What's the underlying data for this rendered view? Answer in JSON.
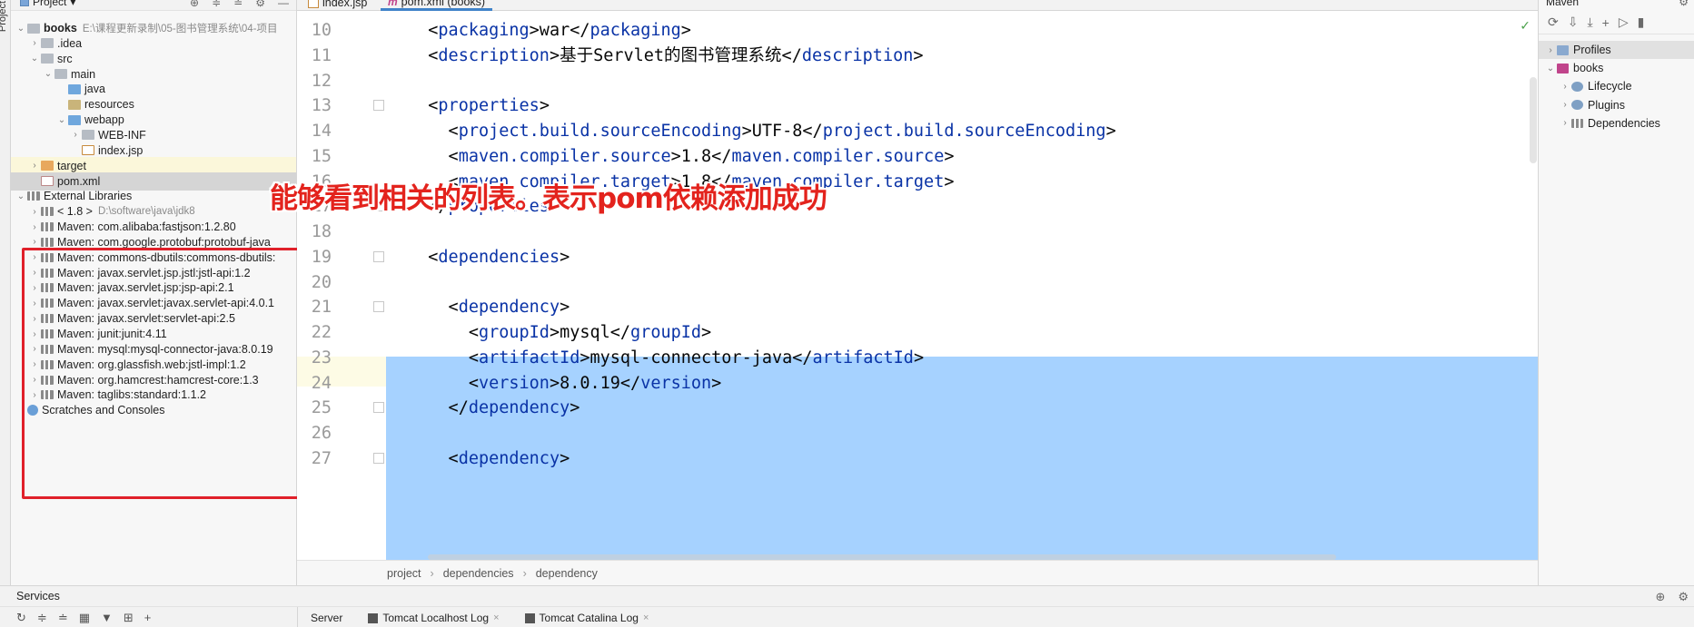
{
  "left_strip": {
    "label": "Project"
  },
  "project_panel": {
    "title": "Project",
    "tools": [
      "⊕",
      "≑",
      "≐",
      "⚙",
      "—"
    ],
    "root": {
      "name": "books",
      "path": "E:\\课程更新录制\\05-图书管理系统\\04-项目"
    },
    "items": [
      {
        "label": "books",
        "extra": "E:\\课程更新录制\\05-图书管理系统\\04-项目",
        "indent": 0,
        "arrow": "⌄",
        "icon": "folder",
        "bold": true,
        "name": "tree-root-books"
      },
      {
        "label": ".idea",
        "extra": "",
        "indent": 1,
        "arrow": "›",
        "icon": "folder",
        "name": "tree-idea"
      },
      {
        "label": "src",
        "extra": "",
        "indent": 1,
        "arrow": "⌄",
        "icon": "folder",
        "name": "tree-src"
      },
      {
        "label": "main",
        "extra": "",
        "indent": 2,
        "arrow": "⌄",
        "icon": "folder",
        "name": "tree-main"
      },
      {
        "label": "java",
        "extra": "",
        "indent": 3,
        "arrow": "",
        "icon": "bfolder",
        "name": "tree-java"
      },
      {
        "label": "resources",
        "extra": "",
        "indent": 3,
        "arrow": "",
        "icon": "rfolder",
        "name": "tree-resources"
      },
      {
        "label": "webapp",
        "extra": "",
        "indent": 3,
        "arrow": "⌄",
        "icon": "bfolder",
        "name": "tree-webapp"
      },
      {
        "label": "WEB-INF",
        "extra": "",
        "indent": 4,
        "arrow": "›",
        "icon": "folder",
        "name": "tree-web-inf"
      },
      {
        "label": "index.jsp",
        "extra": "",
        "indent": 4,
        "arrow": "",
        "icon": "jsp",
        "name": "tree-index-jsp"
      },
      {
        "label": "target",
        "extra": "",
        "indent": 1,
        "arrow": "›",
        "icon": "ofolder",
        "hl": "yellow",
        "name": "tree-target"
      },
      {
        "label": "pom.xml",
        "extra": "",
        "indent": 1,
        "arrow": "",
        "icon": "file-m",
        "hl": "sel",
        "name": "tree-pom-xml"
      },
      {
        "label": "External Libraries",
        "extra": "",
        "indent": 0,
        "arrow": "⌄",
        "icon": "lib",
        "name": "tree-external-libraries"
      },
      {
        "label": "< 1.8 >",
        "extra": "D:\\software\\java\\jdk8",
        "indent": 1,
        "arrow": "›",
        "icon": "lib",
        "name": "tree-jdk"
      },
      {
        "label": "Maven: com.alibaba:fastjson:1.2.80",
        "extra": "",
        "indent": 1,
        "arrow": "›",
        "icon": "lib",
        "name": "tree-lib-fastjson"
      },
      {
        "label": "Maven: com.google.protobuf:protobuf-java",
        "extra": "",
        "indent": 1,
        "arrow": "›",
        "icon": "lib",
        "name": "tree-lib-protobuf"
      },
      {
        "label": "Maven: commons-dbutils:commons-dbutils:",
        "extra": "",
        "indent": 1,
        "arrow": "›",
        "icon": "lib",
        "name": "tree-lib-dbutils"
      },
      {
        "label": "Maven: javax.servlet.jsp.jstl:jstl-api:1.2",
        "extra": "",
        "indent": 1,
        "arrow": "›",
        "icon": "lib",
        "name": "tree-lib-jstl-api"
      },
      {
        "label": "Maven: javax.servlet.jsp:jsp-api:2.1",
        "extra": "",
        "indent": 1,
        "arrow": "›",
        "icon": "lib",
        "name": "tree-lib-jsp-api"
      },
      {
        "label": "Maven: javax.servlet:javax.servlet-api:4.0.1",
        "extra": "",
        "indent": 1,
        "arrow": "›",
        "icon": "lib",
        "name": "tree-lib-javax-servlet-api"
      },
      {
        "label": "Maven: javax.servlet:servlet-api:2.5",
        "extra": "",
        "indent": 1,
        "arrow": "›",
        "icon": "lib",
        "name": "tree-lib-servlet-api"
      },
      {
        "label": "Maven: junit:junit:4.11",
        "extra": "",
        "indent": 1,
        "arrow": "›",
        "icon": "lib",
        "name": "tree-lib-junit"
      },
      {
        "label": "Maven: mysql:mysql-connector-java:8.0.19",
        "extra": "",
        "indent": 1,
        "arrow": "›",
        "icon": "lib",
        "name": "tree-lib-mysql"
      },
      {
        "label": "Maven: org.glassfish.web:jstl-impl:1.2",
        "extra": "",
        "indent": 1,
        "arrow": "›",
        "icon": "lib",
        "name": "tree-lib-jstl-impl"
      },
      {
        "label": "Maven: org.hamcrest:hamcrest-core:1.3",
        "extra": "",
        "indent": 1,
        "arrow": "›",
        "icon": "lib",
        "name": "tree-lib-hamcrest"
      },
      {
        "label": "Maven: taglibs:standard:1.1.2",
        "extra": "",
        "indent": 1,
        "arrow": "›",
        "icon": "lib",
        "name": "tree-lib-taglibs"
      },
      {
        "label": "Scratches and Consoles",
        "extra": "",
        "indent": 0,
        "arrow": "",
        "icon": "scratch",
        "name": "tree-scratches"
      }
    ]
  },
  "editor": {
    "tabs": [
      {
        "label": "index.jsp",
        "icon": "jsp",
        "active": false
      },
      {
        "label": "pom.xml (books)",
        "icon": "m",
        "active": true
      }
    ],
    "lines": [
      {
        "num": "10",
        "code": "  <packaging>war</packaging>",
        "fold": false
      },
      {
        "num": "11",
        "code": "  <description>基于Servlet的图书管理系统</description>",
        "fold": false
      },
      {
        "num": "12",
        "code": "",
        "fold": false
      },
      {
        "num": "13",
        "code": "  <properties>",
        "fold": true
      },
      {
        "num": "14",
        "code": "    <project.build.sourceEncoding>UTF-8</project.build.sourceEncoding>",
        "fold": false
      },
      {
        "num": "15",
        "code": "    <maven.compiler.source>1.8</maven.compiler.source>",
        "fold": false
      },
      {
        "num": "16",
        "code": "    <maven.compiler.target>1.8</maven.compiler.target>",
        "fold": false
      },
      {
        "num": "17",
        "code": "  </properties>",
        "fold": true
      },
      {
        "num": "18",
        "code": "",
        "fold": false
      },
      {
        "num": "19",
        "code": "  <dependencies>",
        "fold": true
      },
      {
        "num": "20",
        "code": "",
        "fold": false
      },
      {
        "num": "21",
        "code": "    <dependency>",
        "fold": true
      },
      {
        "num": "22",
        "code": "      <groupId>mysql</groupId>",
        "fold": false
      },
      {
        "num": "23",
        "code": "      <artifactId>mysql-connector-java</artifactId>",
        "fold": false
      },
      {
        "num": "24",
        "code": "      <version>8.0.19</version>",
        "fold": false
      },
      {
        "num": "25",
        "code": "    </dependency>",
        "fold": true
      },
      {
        "num": "26",
        "code": "",
        "fold": false
      },
      {
        "num": "27",
        "code": "    <dependency>",
        "fold": true
      }
    ],
    "breadcrumb": [
      "project",
      "dependencies",
      "dependency"
    ],
    "status_mark": "✓",
    "caption": "能够看到相关的列表。表示pom依赖添加成功"
  },
  "maven_panel": {
    "title": "Maven",
    "gear": "⚙",
    "tools": [
      "⟳",
      "⇩",
      "⤓",
      "+",
      "▷",
      "▮"
    ],
    "items": [
      {
        "label": "Profiles",
        "indent": 0,
        "arrow": "›",
        "icon": "prof",
        "hl": true,
        "name": "maven-profiles"
      },
      {
        "label": "books",
        "indent": 0,
        "arrow": "⌄",
        "icon": "m",
        "hl": false,
        "name": "maven-books"
      },
      {
        "label": "Lifecycle",
        "indent": 1,
        "arrow": "›",
        "icon": "gear",
        "hl": false,
        "name": "maven-lifecycle"
      },
      {
        "label": "Plugins",
        "indent": 1,
        "arrow": "›",
        "icon": "gear",
        "hl": false,
        "name": "maven-plugins"
      },
      {
        "label": "Dependencies",
        "indent": 1,
        "arrow": "›",
        "icon": "lib",
        "hl": false,
        "name": "maven-dependencies"
      }
    ]
  },
  "services": {
    "title": "Services",
    "right_icons": [
      "⊕",
      "⚙"
    ],
    "buttons": [
      "↻",
      "≑",
      "≐",
      "▦",
      "▼",
      "⊞",
      "+"
    ],
    "tabs": [
      {
        "label": "Server",
        "closable": false
      },
      {
        "label": "Tomcat Localhost Log",
        "closable": true
      },
      {
        "label": "Tomcat Catalina Log",
        "closable": true
      }
    ],
    "close_glyph": "×"
  }
}
